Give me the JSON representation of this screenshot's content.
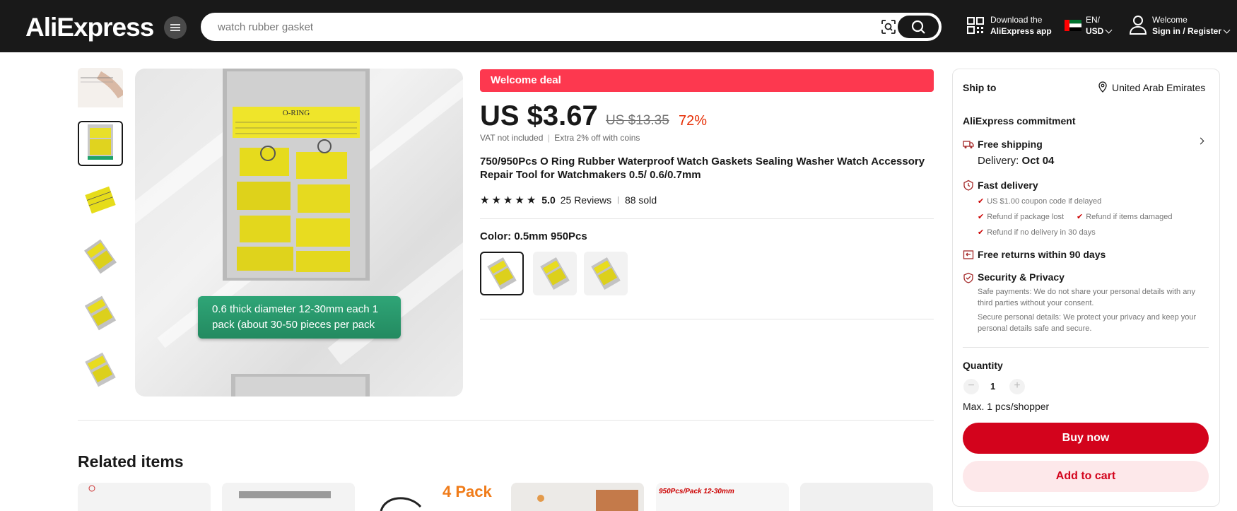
{
  "header": {
    "logo": "AliExpress",
    "search_placeholder": "watch rubber gasket",
    "download_line1": "Download the",
    "download_line2": "AliExpress app",
    "lang": "EN/",
    "currency": "USD",
    "welcome": "Welcome",
    "signin": "Sign in / Register"
  },
  "product": {
    "deal_banner": "Welcome deal",
    "price": "US $3.67",
    "original_price": "US $13.35",
    "discount": "72%",
    "vat_note": "VAT not included",
    "coins_note": "Extra 2% off with coins",
    "title": "750/950Pcs O Ring Rubber Waterproof Watch Gaskets Sealing Washer Watch Accessory Repair Tool for Watchmakers 0.5/ 0.6/0.7mm",
    "rating": "5.0",
    "reviews": "25 Reviews",
    "sold": "88 sold",
    "color_label": "Color: 0.5mm 950Pcs",
    "image_caption": "0.6 thick diameter 12-30mm each 1 pack (about 30-50 pieces per pack",
    "package_label": "O-RING"
  },
  "panel": {
    "ship_to_label": "Ship to",
    "ship_to_country": "United Arab Emirates",
    "commitment": "AliExpress commitment",
    "free_shipping": "Free shipping",
    "delivery_label": "Delivery:",
    "delivery_date": "Oct 04",
    "fast_delivery": "Fast delivery",
    "fd_1": "US $1.00 coupon code if delayed",
    "fd_2": "Refund if package lost",
    "fd_3": "Refund if items damaged",
    "fd_4": "Refund if no delivery in 30 days",
    "free_returns": "Free returns within 90 days",
    "security": "Security & Privacy",
    "sec_1": "Safe payments: We do not share your personal details with any third parties without your consent.",
    "sec_2": "Secure personal details: We protect your privacy and keep your personal details safe and secure.",
    "quantity_label": "Quantity",
    "quantity_value": "1",
    "max_note": "Max. 1 pcs/shopper",
    "buy_now": "Buy now",
    "add_to_cart": "Add to cart"
  },
  "related": {
    "title": "Related items",
    "card_3_text": "4 Pack",
    "card_5_text": "950Pcs/Pack 12-30mm"
  },
  "colors": {
    "brand_red": "#d3031c",
    "deal_red": "#fd384f",
    "header_bg": "#191919",
    "caption_green": "#2fa577"
  }
}
